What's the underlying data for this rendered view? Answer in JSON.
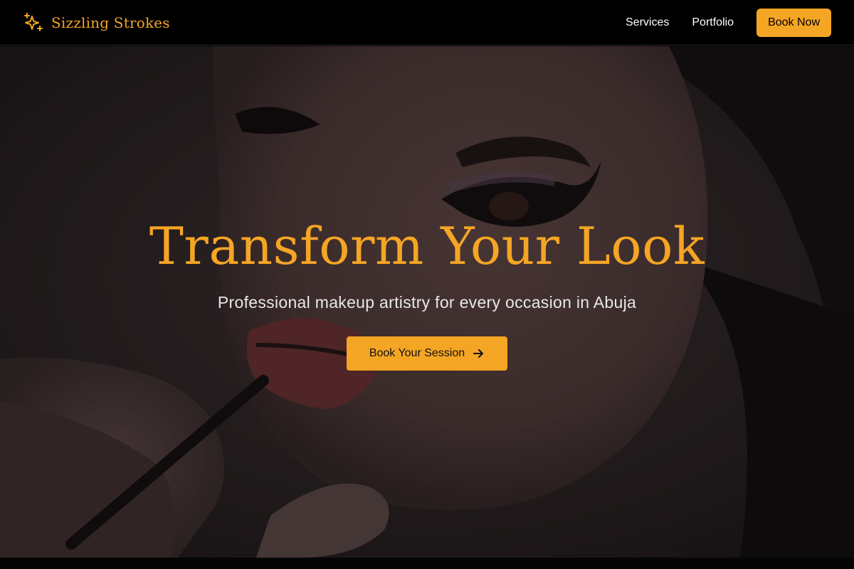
{
  "brand": {
    "name": "Sizzling Strokes",
    "icon": "sparkles-icon"
  },
  "nav": {
    "links": [
      {
        "label": "Services"
      },
      {
        "label": "Portfolio"
      }
    ],
    "cta_label": "Book Now"
  },
  "hero": {
    "title": "Transform Your Look",
    "subtitle": "Professional makeup artistry for every occasion in Abuja",
    "cta_label": "Book Your Session",
    "cta_icon": "arrow-right-icon",
    "image": "makeup-artist-applying-lipstick-photo"
  },
  "colors": {
    "accent": "#f5a524",
    "navbar_bg": "#000000",
    "text_light": "#ffffff"
  }
}
